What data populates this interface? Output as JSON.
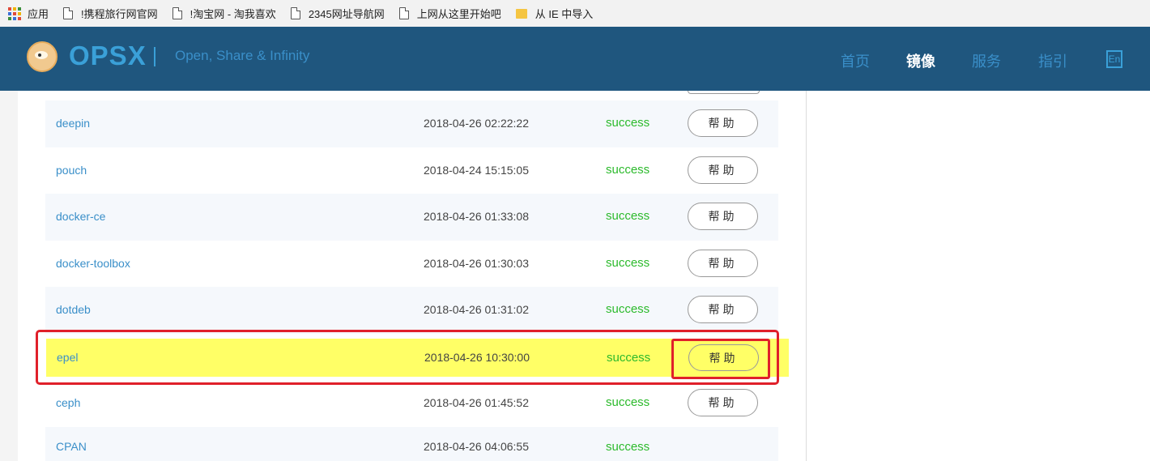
{
  "bookmarks": [
    {
      "label": "应用",
      "icon": "apps-grid-icon"
    },
    {
      "label": "!携程旅行网官网",
      "icon": "page-icon"
    },
    {
      "label": "!淘宝网 - 淘我喜欢",
      "icon": "page-icon"
    },
    {
      "label": "2345网址导航网",
      "icon": "page-icon"
    },
    {
      "label": "上网从这里开始吧",
      "icon": "page-icon"
    },
    {
      "label": "从 IE 中导入",
      "icon": "folder-icon"
    }
  ],
  "navbar": {
    "brand": "OPSX",
    "slogan": "Open, Share & Infinity",
    "items": [
      "首页",
      "镜像",
      "服务",
      "指引"
    ],
    "active_item": "镜像",
    "lang_button": "En"
  },
  "help_label": "帮助",
  "mirrors": [
    {
      "name": "deepin",
      "time": "2018-04-26 02:22:22",
      "status": "success",
      "help": "帮助"
    },
    {
      "name": "pouch",
      "time": "2018-04-24 15:15:05",
      "status": "success",
      "help": "帮助"
    },
    {
      "name": "docker-ce",
      "time": "2018-04-26 01:33:08",
      "status": "success",
      "help": "帮助"
    },
    {
      "name": "docker-toolbox",
      "time": "2018-04-26 01:30:03",
      "status": "success",
      "help": "帮助"
    },
    {
      "name": "dotdeb",
      "time": "2018-04-26 01:31:02",
      "status": "success",
      "help": "帮助"
    },
    {
      "name": "epel",
      "time": "2018-04-26 10:30:00",
      "status": "success",
      "help": "帮助"
    },
    {
      "name": "ceph",
      "time": "2018-04-26 01:45:52",
      "status": "success",
      "help": "帮助"
    },
    {
      "name": "CPAN",
      "time": "2018-04-26 04:06:55",
      "status": "success",
      "help": ""
    }
  ],
  "colors": {
    "navbar_bg": "#1f567e",
    "brand": "#3aa0d8",
    "success": "#2cba2c",
    "highlight": "#ffff66",
    "annotation_red": "#e0202a"
  }
}
